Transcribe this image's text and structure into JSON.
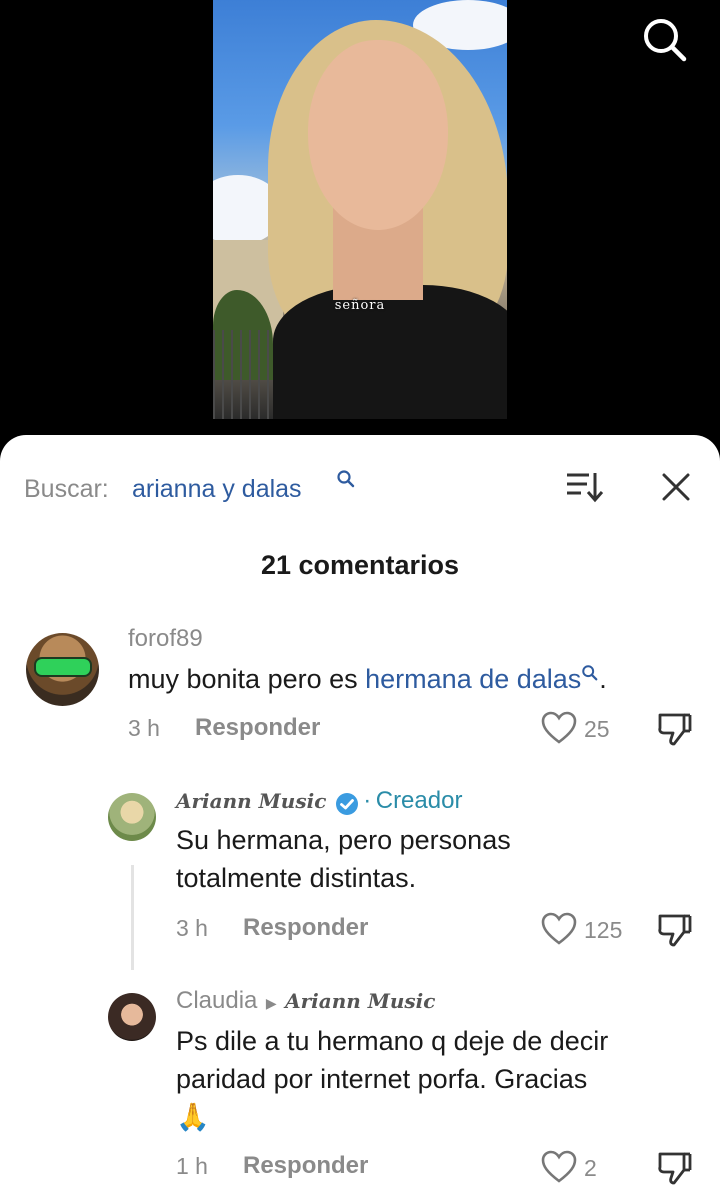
{
  "video": {
    "caption": "señora"
  },
  "sheet": {
    "search_prefix": "Buscar:",
    "search_term": "arianna y dalas",
    "comment_count": "21 comentarios"
  },
  "comments": [
    {
      "username": "forof89",
      "text_plain": "muy bonita pero es ",
      "text_link": "hermana de dalas",
      "text_after": ".",
      "time": "3 h",
      "reply_label": "Responder",
      "likes": "25"
    },
    {
      "username": "Ariann Music",
      "badge_sep": "·",
      "creator_label": "Creador",
      "text_line1": "Su hermana, pero personas",
      "text_line2": "totalmente distintas.",
      "time": "3 h",
      "reply_label": "Responder",
      "likes": "125"
    },
    {
      "username": "Claudia",
      "reply_to": "Ariann Music",
      "text_line1": "Ps dile a tu hermano q deje de decir",
      "text_line2": "paridad por internet porfa. Gracias",
      "text_line3": "🙏",
      "time": "1 h",
      "reply_label": "Responder",
      "likes": "2"
    }
  ],
  "colors": {
    "link": "#2e5b9f",
    "creator": "#2a8ca8",
    "verified": "#3a9be0"
  }
}
